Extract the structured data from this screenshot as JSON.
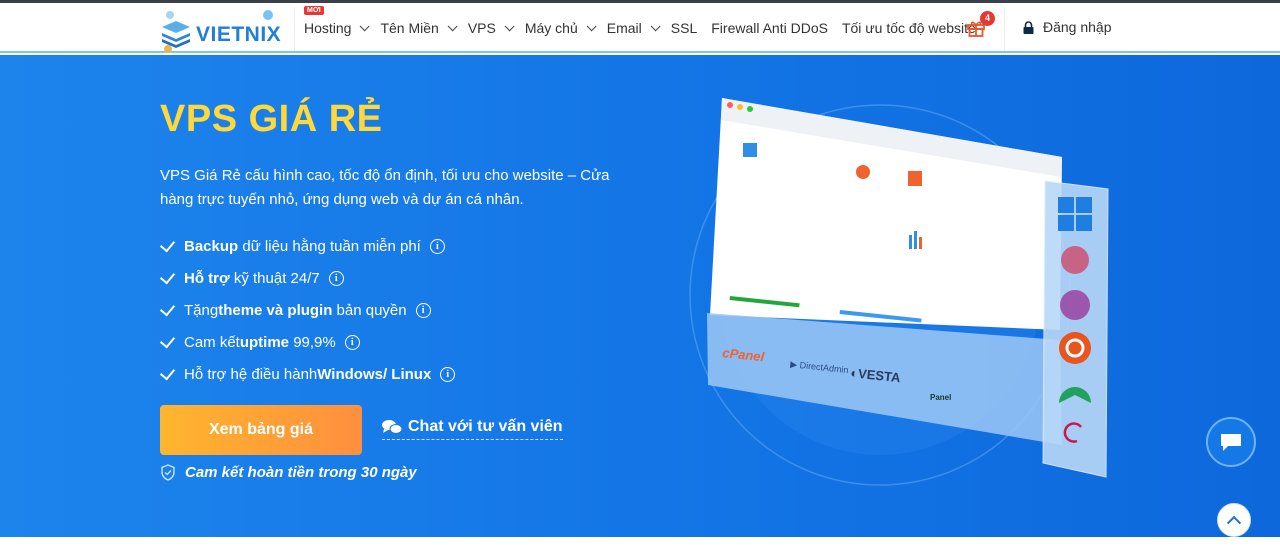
{
  "brand": {
    "name": "VIETNIX"
  },
  "nav": {
    "items": [
      {
        "label": "Hosting",
        "badge": "MỚI",
        "dropdown": true
      },
      {
        "label": "Tên Miền",
        "dropdown": true
      },
      {
        "label": "VPS",
        "dropdown": true
      },
      {
        "label": "Máy chủ",
        "dropdown": true
      },
      {
        "label": "Email",
        "dropdown": true
      },
      {
        "label": "SSL",
        "dropdown": false
      },
      {
        "label": "Firewall Anti DDoS",
        "dropdown": false
      },
      {
        "label": "Tối ưu tốc độ website",
        "dropdown": false
      }
    ],
    "gift_count": "4",
    "login": "Đăng nhập"
  },
  "hero": {
    "title": "VPS GIÁ RẺ",
    "description": "VPS Giá Rẻ cấu hình cao, tốc độ ổn định, tối ưu cho website – Cửa hàng trực tuyến nhỏ, ứng dụng web và dự án cá nhân.",
    "features": [
      {
        "bold": "Backup",
        "text": " dữ liệu hằng tuần miễn phí"
      },
      {
        "bold": "Hỗ trợ",
        "text": " kỹ thuật 24/7"
      },
      {
        "pre": "Tặng ",
        "bold": "theme và plugin",
        "text": " bản quyền"
      },
      {
        "pre": "Cam kết ",
        "bold": "uptime",
        "text": " 99,9%"
      },
      {
        "pre": "Hỗ trợ hệ điều hành ",
        "bold": "Windows/ Linux",
        "text": ""
      }
    ],
    "cta": "Xem bảng giá",
    "chat": "Chat với tư vấn viên",
    "refund": "Cam kết hoàn tiền trong 30 ngày",
    "illustration_logos": [
      "cPanel",
      "DirectAdmin",
      "VESTA",
      "Panel"
    ]
  },
  "colors": {
    "accent": "#ffd83a",
    "hero_bg": "#1476e6",
    "cta_start": "#ffb52e",
    "cta_end": "#ff8f3f",
    "badge": "#e53935"
  }
}
